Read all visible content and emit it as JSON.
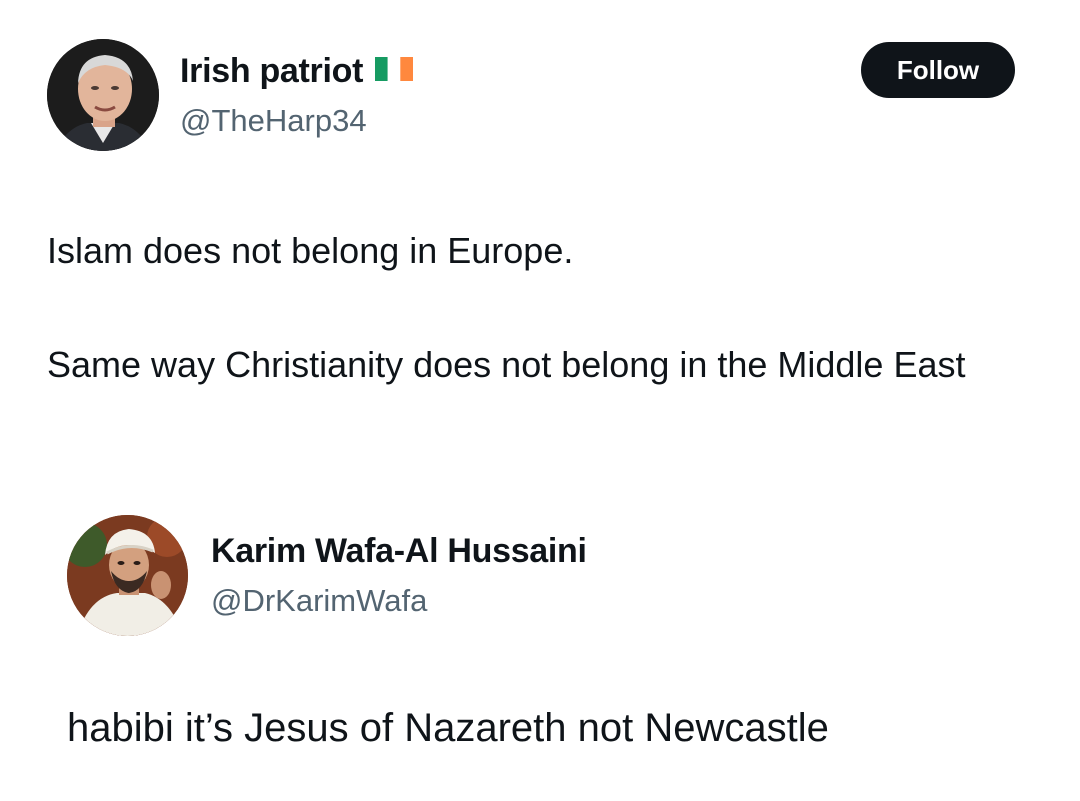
{
  "tweet": {
    "author": {
      "display_name": "Irish patriot",
      "handle": "@TheHarp34",
      "badge": "ireland-flag-icon"
    },
    "follow_label": "Follow",
    "paragraphs": [
      "Islam does not belong in Europe.",
      "Same way Christianity does not belong in the Middle East"
    ]
  },
  "reply": {
    "author": {
      "display_name": "Karim Wafa-Al Hussaini",
      "handle": "@DrKarimWafa"
    },
    "text": "habibi it’s Jesus of Nazareth not Newcastle"
  },
  "colors": {
    "text": "#0f1419",
    "secondary_text": "#536471",
    "button_bg": "#0f1419",
    "button_text": "#ffffff",
    "flag_green": "#169b62",
    "flag_white": "#ffffff",
    "flag_orange": "#ff883e"
  }
}
